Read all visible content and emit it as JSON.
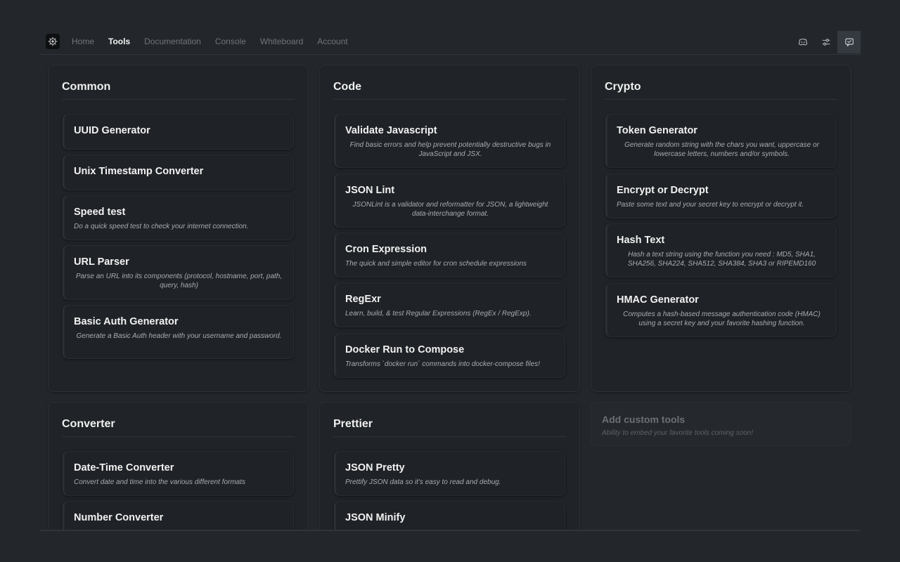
{
  "nav": {
    "links": [
      {
        "label": "Home",
        "active": false
      },
      {
        "label": "Tools",
        "active": true
      },
      {
        "label": "Documentation",
        "active": false
      },
      {
        "label": "Console",
        "active": false
      },
      {
        "label": "Whiteboard",
        "active": false
      },
      {
        "label": "Account",
        "active": false
      }
    ],
    "icons": [
      "discord-icon",
      "settings-sliders-icon",
      "feedback-icon"
    ]
  },
  "sections": {
    "common": {
      "title": "Common",
      "tools": [
        {
          "title": "UUID Generator",
          "desc": ""
        },
        {
          "title": "Unix Timestamp Converter",
          "desc": ""
        },
        {
          "title": "Speed test",
          "desc": "Do a quick speed test to check your internet connection."
        },
        {
          "title": "URL Parser",
          "desc": "Parse an URL into its components (protocol, hostname, port, path, query, hash)"
        },
        {
          "title": "Basic Auth Generator",
          "desc": "Generate a Basic Auth header with your username and password."
        }
      ]
    },
    "code": {
      "title": "Code",
      "tools": [
        {
          "title": "Validate Javascript",
          "desc": "Find basic errors and help prevent potentially destructive bugs in JavaScript and JSX."
        },
        {
          "title": "JSON Lint",
          "desc": "JSONLint is a validator and reformatter for JSON, a lightweight data-interchange format."
        },
        {
          "title": "Cron Expression",
          "desc": "The quick and simple editor for cron schedule expressions"
        },
        {
          "title": "RegExr",
          "desc": "Learn, build, & test Regular Expressions (RegEx / RegExp)."
        },
        {
          "title": "Docker Run to Compose",
          "desc": "Transforms `docker run` commands into docker-compose files!"
        }
      ]
    },
    "crypto": {
      "title": "Crypto",
      "tools": [
        {
          "title": "Token Generator",
          "desc": "Generate random string with the chars you want, uppercase or lowercase letters, numbers and/or symbols."
        },
        {
          "title": "Encrypt or Decrypt",
          "desc": "Paste some text and your secret key to encrypt or decrypt it."
        },
        {
          "title": "Hash Text",
          "desc": "Hash a text string using the function you need : MD5, SHA1, SHA256, SHA224, SHA512, SHA384, SHA3 or RIPEMD160"
        },
        {
          "title": "HMAC Generator",
          "desc": "Computes a hash-based message authentication code (HMAC) using a secret key and your favorite hashing function."
        }
      ]
    },
    "converter": {
      "title": "Converter",
      "tools": [
        {
          "title": "Date-Time Converter",
          "desc": "Convert date and time into the various different formats"
        },
        {
          "title": "Number Converter",
          "desc": ""
        }
      ]
    },
    "prettier": {
      "title": "Prettier",
      "tools": [
        {
          "title": "JSON Pretty",
          "desc": "Prettify JSON data so it's easy to read and debug."
        },
        {
          "title": "JSON Minify",
          "desc": ""
        }
      ]
    }
  },
  "custom": {
    "title": "Add custom tools",
    "desc": "Ability to embed your favorite tools coming soon!"
  }
}
